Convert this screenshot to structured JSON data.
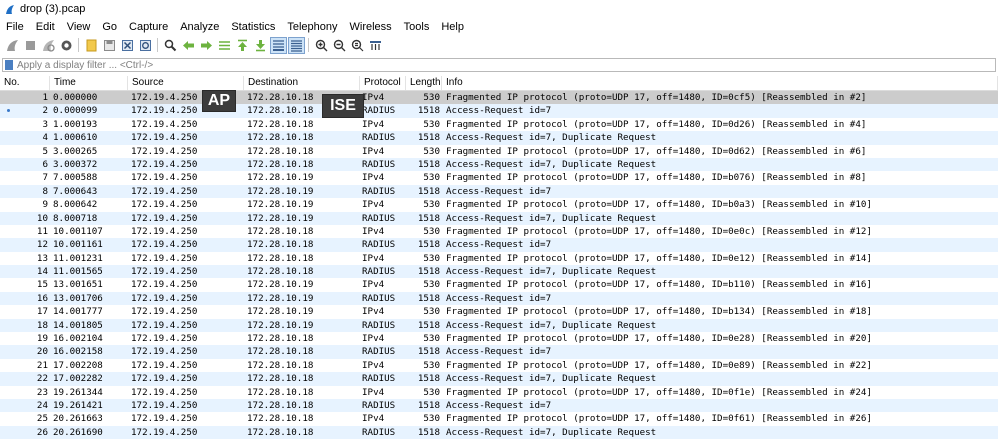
{
  "window": {
    "title": "drop (3).pcap",
    "icon": "wireshark-fin-icon"
  },
  "menu": [
    "File",
    "Edit",
    "View",
    "Go",
    "Capture",
    "Analyze",
    "Statistics",
    "Telephony",
    "Wireless",
    "Tools",
    "Help"
  ],
  "toolbar": {
    "icons": [
      "shark-fin-start-icon",
      "stop-square-icon",
      "restart-fin-icon",
      "capture-options-gear-icon",
      "open-folder-icon",
      "save-file-icon",
      "close-file-x-icon",
      "reload-file-icon",
      "find-packet-magnifier-icon",
      "go-back-arrow-icon",
      "go-forward-arrow-icon",
      "go-to-packet-icon",
      "go-first-packet-icon",
      "go-last-packet-icon",
      "autoscroll-icon",
      "colorize-icon",
      "zoom-in-icon",
      "zoom-out-icon",
      "normal-size-icon",
      "resize-columns-icon"
    ]
  },
  "filter": {
    "placeholder": "Apply a display filter ... <Ctrl-/>"
  },
  "columns": {
    "no": "No.",
    "time": "Time",
    "source": "Source",
    "destination": "Destination",
    "protocol": "Protocol",
    "length": "Length",
    "info": "Info"
  },
  "callouts": {
    "ap": "AP",
    "ise": "ISE"
  },
  "packets": [
    {
      "no": "1",
      "time": "0.000000",
      "src": "172.19.4.250",
      "dst": "172.28.10.18",
      "proto": "IPv4",
      "len": "530",
      "info": "Fragmented IP protocol (proto=UDP 17, off=1480, ID=0cf5) [Reassembled in #2]"
    },
    {
      "no": "2",
      "time": "0.000099",
      "src": "172.19.4.250",
      "dst": "172.28.10.18",
      "proto": "RADIUS",
      "len": "1518",
      "info": "Access-Request id=7"
    },
    {
      "no": "3",
      "time": "1.000193",
      "src": "172.19.4.250",
      "dst": "172.28.10.18",
      "proto": "IPv4",
      "len": "530",
      "info": "Fragmented IP protocol (proto=UDP 17, off=1480, ID=0d26) [Reassembled in #4]"
    },
    {
      "no": "4",
      "time": "1.000610",
      "src": "172.19.4.250",
      "dst": "172.28.10.18",
      "proto": "RADIUS",
      "len": "1518",
      "info": "Access-Request id=7, Duplicate Request"
    },
    {
      "no": "5",
      "time": "3.000265",
      "src": "172.19.4.250",
      "dst": "172.28.10.18",
      "proto": "IPv4",
      "len": "530",
      "info": "Fragmented IP protocol (proto=UDP 17, off=1480, ID=0d62) [Reassembled in #6]"
    },
    {
      "no": "6",
      "time": "3.000372",
      "src": "172.19.4.250",
      "dst": "172.28.10.18",
      "proto": "RADIUS",
      "len": "1518",
      "info": "Access-Request id=7, Duplicate Request"
    },
    {
      "no": "7",
      "time": "7.000588",
      "src": "172.19.4.250",
      "dst": "172.28.10.19",
      "proto": "IPv4",
      "len": "530",
      "info": "Fragmented IP protocol (proto=UDP 17, off=1480, ID=b076) [Reassembled in #8]"
    },
    {
      "no": "8",
      "time": "7.000643",
      "src": "172.19.4.250",
      "dst": "172.28.10.19",
      "proto": "RADIUS",
      "len": "1518",
      "info": "Access-Request id=7"
    },
    {
      "no": "9",
      "time": "8.000642",
      "src": "172.19.4.250",
      "dst": "172.28.10.19",
      "proto": "IPv4",
      "len": "530",
      "info": "Fragmented IP protocol (proto=UDP 17, off=1480, ID=b0a3) [Reassembled in #10]"
    },
    {
      "no": "10",
      "time": "8.000718",
      "src": "172.19.4.250",
      "dst": "172.28.10.19",
      "proto": "RADIUS",
      "len": "1518",
      "info": "Access-Request id=7, Duplicate Request"
    },
    {
      "no": "11",
      "time": "10.001107",
      "src": "172.19.4.250",
      "dst": "172.28.10.18",
      "proto": "IPv4",
      "len": "530",
      "info": "Fragmented IP protocol (proto=UDP 17, off=1480, ID=0e0c) [Reassembled in #12]"
    },
    {
      "no": "12",
      "time": "10.001161",
      "src": "172.19.4.250",
      "dst": "172.28.10.18",
      "proto": "RADIUS",
      "len": "1518",
      "info": "Access-Request id=7"
    },
    {
      "no": "13",
      "time": "11.001231",
      "src": "172.19.4.250",
      "dst": "172.28.10.18",
      "proto": "IPv4",
      "len": "530",
      "info": "Fragmented IP protocol (proto=UDP 17, off=1480, ID=0e12) [Reassembled in #14]"
    },
    {
      "no": "14",
      "time": "11.001565",
      "src": "172.19.4.250",
      "dst": "172.28.10.18",
      "proto": "RADIUS",
      "len": "1518",
      "info": "Access-Request id=7, Duplicate Request"
    },
    {
      "no": "15",
      "time": "13.001651",
      "src": "172.19.4.250",
      "dst": "172.28.10.19",
      "proto": "IPv4",
      "len": "530",
      "info": "Fragmented IP protocol (proto=UDP 17, off=1480, ID=b110) [Reassembled in #16]"
    },
    {
      "no": "16",
      "time": "13.001706",
      "src": "172.19.4.250",
      "dst": "172.28.10.19",
      "proto": "RADIUS",
      "len": "1518",
      "info": "Access-Request id=7"
    },
    {
      "no": "17",
      "time": "14.001777",
      "src": "172.19.4.250",
      "dst": "172.28.10.19",
      "proto": "IPv4",
      "len": "530",
      "info": "Fragmented IP protocol (proto=UDP 17, off=1480, ID=b134) [Reassembled in #18]"
    },
    {
      "no": "18",
      "time": "14.001805",
      "src": "172.19.4.250",
      "dst": "172.28.10.19",
      "proto": "RADIUS",
      "len": "1518",
      "info": "Access-Request id=7, Duplicate Request"
    },
    {
      "no": "19",
      "time": "16.002104",
      "src": "172.19.4.250",
      "dst": "172.28.10.18",
      "proto": "IPv4",
      "len": "530",
      "info": "Fragmented IP protocol (proto=UDP 17, off=1480, ID=0e28) [Reassembled in #20]"
    },
    {
      "no": "20",
      "time": "16.002158",
      "src": "172.19.4.250",
      "dst": "172.28.10.18",
      "proto": "RADIUS",
      "len": "1518",
      "info": "Access-Request id=7"
    },
    {
      "no": "21",
      "time": "17.002208",
      "src": "172.19.4.250",
      "dst": "172.28.10.18",
      "proto": "IPv4",
      "len": "530",
      "info": "Fragmented IP protocol (proto=UDP 17, off=1480, ID=0e89) [Reassembled in #22]"
    },
    {
      "no": "22",
      "time": "17.002282",
      "src": "172.19.4.250",
      "dst": "172.28.10.18",
      "proto": "RADIUS",
      "len": "1518",
      "info": "Access-Request id=7, Duplicate Request"
    },
    {
      "no": "23",
      "time": "19.261344",
      "src": "172.19.4.250",
      "dst": "172.28.10.18",
      "proto": "IPv4",
      "len": "530",
      "info": "Fragmented IP protocol (proto=UDP 17, off=1480, ID=0f1e) [Reassembled in #24]"
    },
    {
      "no": "24",
      "time": "19.261421",
      "src": "172.19.4.250",
      "dst": "172.28.10.18",
      "proto": "RADIUS",
      "len": "1518",
      "info": "Access-Request id=7"
    },
    {
      "no": "25",
      "time": "20.261663",
      "src": "172.19.4.250",
      "dst": "172.28.10.18",
      "proto": "IPv4",
      "len": "530",
      "info": "Fragmented IP protocol (proto=UDP 17, off=1480, ID=0f61) [Reassembled in #26]"
    },
    {
      "no": "26",
      "time": "20.261690",
      "src": "172.19.4.250",
      "dst": "172.28.10.18",
      "proto": "RADIUS",
      "len": "1518",
      "info": "Access-Request id=7, Duplicate Request"
    }
  ],
  "selected_packet_no": "1",
  "marked_packet_no": "2",
  "colors": {
    "row_alt": "#e7f3ff",
    "row_selected": "#cccccc",
    "callout_bg": "#3c3c3c",
    "fin_blue": "#1f6fc5"
  }
}
